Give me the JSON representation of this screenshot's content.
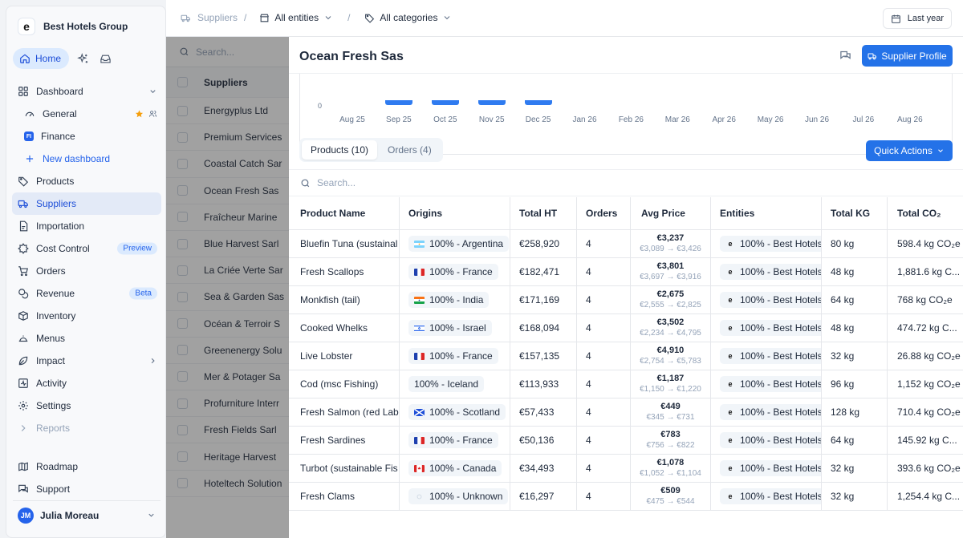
{
  "org": {
    "logo": "e",
    "name": "Best Hotels Group"
  },
  "quick": {
    "home_label": "Home"
  },
  "nav": {
    "dashboard": "Dashboard",
    "general": "General",
    "finance": "Finance",
    "finance_badge": "FI",
    "new_dashboard": "New dashboard",
    "products": "Products",
    "suppliers": "Suppliers",
    "importation": "Importation",
    "cost_control": "Cost Control",
    "cost_control_badge": "Preview",
    "orders": "Orders",
    "revenue": "Revenue",
    "revenue_badge": "Beta",
    "inventory": "Inventory",
    "menus": "Menus",
    "impact": "Impact",
    "activity": "Activity",
    "settings": "Settings",
    "reports": "Reports",
    "roadmap": "Roadmap",
    "support": "Support"
  },
  "user": {
    "initials": "JM",
    "name": "Julia Moreau"
  },
  "topbar": {
    "crumb_suppliers": "Suppliers",
    "sep": "/",
    "entities": "All entities",
    "categories": "All categories",
    "period": "Last year"
  },
  "bg_list": {
    "search_placeholder": "Search...",
    "header": "Suppliers",
    "rows": [
      "Energyplus Ltd",
      "Premium Services",
      "Coastal Catch Sar",
      "Ocean Fresh Sas",
      "Fraîcheur Marine",
      "Blue Harvest Sarl",
      "La Criée Verte Sar",
      "Sea & Garden Sas",
      "Océan & Terroir S",
      "Greenenergy Solu",
      "Mer & Potager Sa",
      "Profurniture Interr",
      "Fresh Fields Sarl",
      "Heritage Harvest",
      "Hoteltech Solution"
    ]
  },
  "panel": {
    "title": "Ocean Fresh Sas",
    "supplier_profile": "Supplier Profile",
    "quick_actions": "Quick Actions",
    "tab_products": "Products (10)",
    "tab_orders": "Orders (4)",
    "search_placeholder": "Search..."
  },
  "chart_data": {
    "type": "bar",
    "title": "",
    "y_tick_visible": "0",
    "categories": [
      "Aug 25",
      "Sep 25",
      "Oct 25",
      "Nov 25",
      "Dec 25",
      "Jan 26",
      "Feb 26",
      "Mar 26",
      "Apr 26",
      "May 26",
      "Jun 26",
      "Jul 26",
      "Aug 26"
    ],
    "has_bar": [
      false,
      true,
      true,
      true,
      true,
      false,
      false,
      false,
      false,
      false,
      false,
      false,
      false
    ],
    "bar_color": "#2f7bf0",
    "note_cropped": true
  },
  "table": {
    "headers": [
      "Product Name",
      "Origins",
      "Total HT",
      "Orders",
      "Avg Price",
      "Entities",
      "Total KG",
      "Total CO₂"
    ],
    "rows": [
      {
        "name": "Bluefin Tuna (sustainal",
        "flag": "ar",
        "origin": "100% - Argentina",
        "ht": "€258,920",
        "orders": "4",
        "avg": "€3,237",
        "range": "€3,089 → €3,426",
        "entity": "100% - Best Hotels",
        "kg": "80 kg",
        "co2": "598.4 kg CO₂e"
      },
      {
        "name": "Fresh Scallops",
        "flag": "fr",
        "origin": "100% - France",
        "ht": "€182,471",
        "orders": "4",
        "avg": "€3,801",
        "range": "€3,697 → €3,916",
        "entity": "100% - Best Hotels",
        "kg": "48 kg",
        "co2": "1,881.6 kg C..."
      },
      {
        "name": "Monkfish (tail)",
        "flag": "in",
        "origin": "100% - India",
        "ht": "€171,169",
        "orders": "4",
        "avg": "€2,675",
        "range": "€2,555 → €2,825",
        "entity": "100% - Best Hotels",
        "kg": "64 kg",
        "co2": "768 kg CO₂e"
      },
      {
        "name": "Cooked Whelks",
        "flag": "il",
        "origin": "100% - Israel",
        "ht": "€168,094",
        "orders": "4",
        "avg": "€3,502",
        "range": "€2,234 → €4,795",
        "entity": "100% - Best Hotels",
        "kg": "48 kg",
        "co2": "474.72 kg C..."
      },
      {
        "name": "Live Lobster",
        "flag": "fr",
        "origin": "100% - France",
        "ht": "€157,135",
        "orders": "4",
        "avg": "€4,910",
        "range": "€2,754 → €5,783",
        "entity": "100% - Best Hotels",
        "kg": "32 kg",
        "co2": "26.88 kg CO₂e"
      },
      {
        "name": "Cod (msc Fishing)",
        "flag": "none",
        "origin": "100% - Iceland",
        "ht": "€113,933",
        "orders": "4",
        "avg": "€1,187",
        "range": "€1,150 → €1,220",
        "entity": "100% - Best Hotels",
        "kg": "96 kg",
        "co2": "1,152 kg CO₂e"
      },
      {
        "name": "Fresh Salmon (red Lab",
        "flag": "sc",
        "origin": "100% - Scotland",
        "ht": "€57,433",
        "orders": "4",
        "avg": "€449",
        "range": "€345 → €731",
        "entity": "100% - Best Hotels",
        "kg": "128 kg",
        "co2": "710.4 kg CO₂e"
      },
      {
        "name": "Fresh Sardines",
        "flag": "fr",
        "origin": "100% - France",
        "ht": "€50,136",
        "orders": "4",
        "avg": "€783",
        "range": "€756 → €822",
        "entity": "100% - Best Hotels",
        "kg": "64 kg",
        "co2": "145.92 kg C..."
      },
      {
        "name": "Turbot (sustainable Fis",
        "flag": "ca",
        "origin": "100% - Canada",
        "ht": "€34,493",
        "orders": "4",
        "avg": "€1,078",
        "range": "€1,052 → €1,104",
        "entity": "100% - Best Hotels",
        "kg": "32 kg",
        "co2": "393.6 kg CO₂e"
      },
      {
        "name": "Fresh Clams",
        "flag": "un",
        "origin": "100% - Unknown",
        "ht": "€16,297",
        "orders": "4",
        "avg": "€509",
        "range": "€475 → €544",
        "entity": "100% - Best Hotels",
        "kg": "32 kg",
        "co2": "1,254.4 kg C..."
      }
    ]
  },
  "colors": {
    "accent": "#2472e8",
    "active_bg": "#e3eaf7",
    "overlay": "rgba(32,32,32,0.42)"
  }
}
